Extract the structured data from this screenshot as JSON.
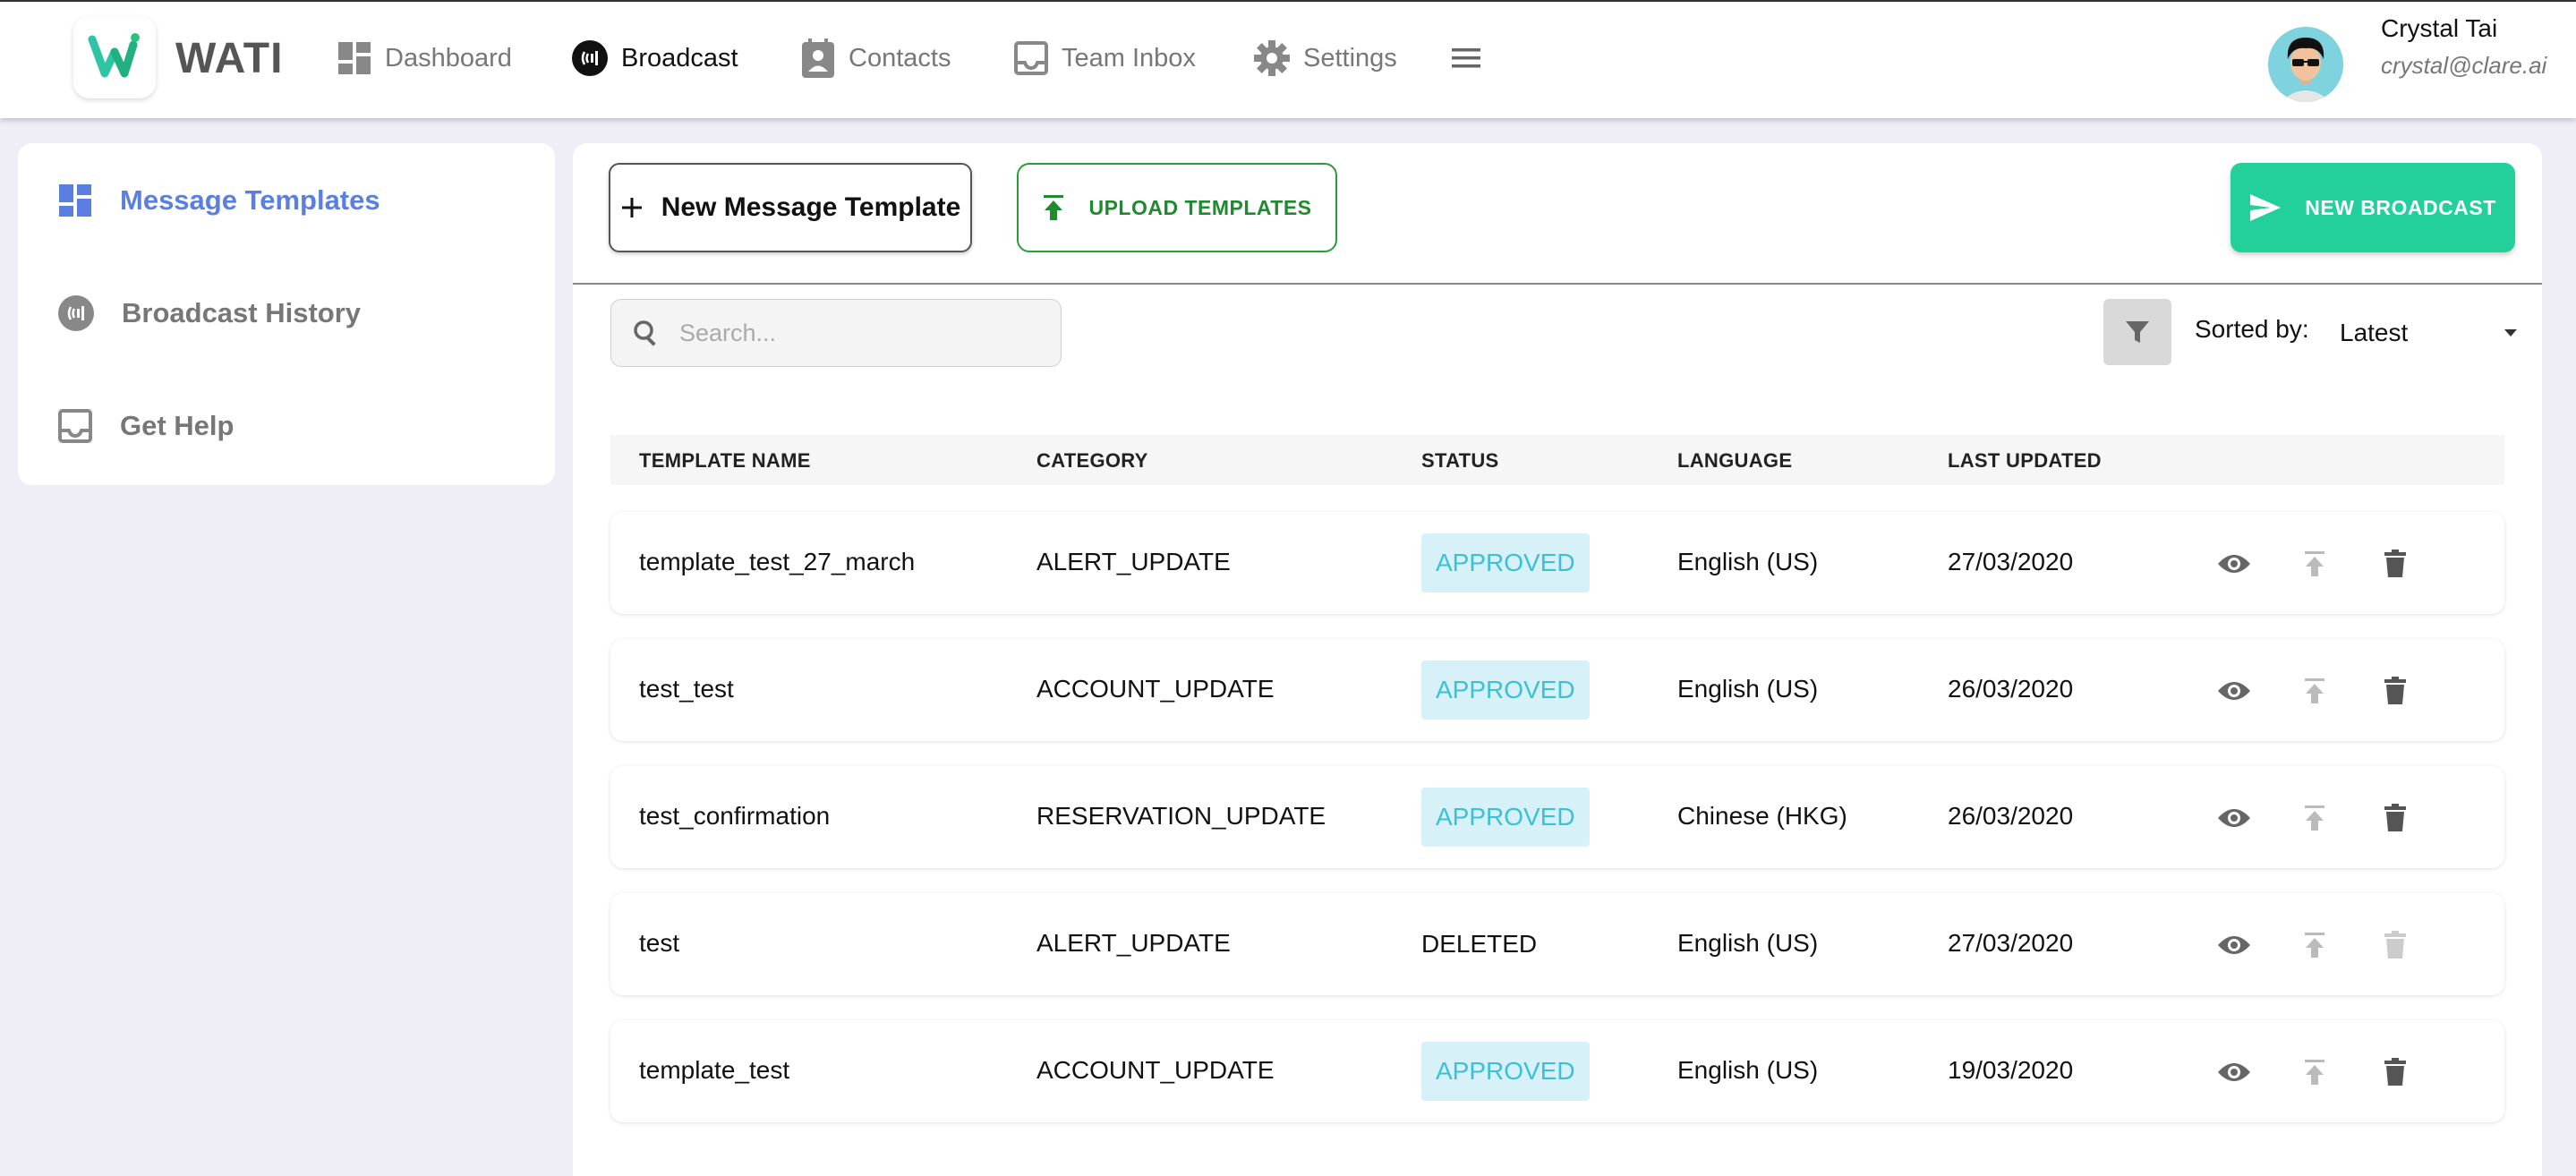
{
  "brand": {
    "name": "WATI"
  },
  "nav": {
    "items": [
      {
        "label": "Dashboard",
        "icon": "dashboard-icon"
      },
      {
        "label": "Broadcast",
        "icon": "broadcast-icon",
        "active": true
      },
      {
        "label": "Contacts",
        "icon": "contacts-icon"
      },
      {
        "label": "Team Inbox",
        "icon": "inbox-icon"
      },
      {
        "label": "Settings",
        "icon": "gear-icon"
      }
    ]
  },
  "user": {
    "name": "Crystal Tai",
    "email": "crystal@clare.ai"
  },
  "sidebar": {
    "items": [
      {
        "label": "Message Templates",
        "icon": "templates-icon",
        "active": true
      },
      {
        "label": "Broadcast History",
        "icon": "broadcast-icon"
      },
      {
        "label": "Get Help",
        "icon": "inbox-icon"
      }
    ]
  },
  "toolbar": {
    "new_template_label": "New Message Template",
    "upload_label": "UPLOAD TEMPLATES",
    "new_broadcast_label": "NEW BROADCAST"
  },
  "search": {
    "placeholder": "Search...",
    "value": ""
  },
  "sort": {
    "label": "Sorted by:",
    "value": "Latest"
  },
  "table": {
    "headers": {
      "name": "TEMPLATE NAME",
      "category": "CATEGORY",
      "status": "STATUS",
      "language": "LANGUAGE",
      "updated": "LAST UPDATED"
    },
    "rows": [
      {
        "name": "template_test_27_march",
        "category": "ALERT_UPDATE",
        "status": "APPROVED",
        "language": "English (US)",
        "updated": "27/03/2020"
      },
      {
        "name": "test_test",
        "category": "ACCOUNT_UPDATE",
        "status": "APPROVED",
        "language": "English (US)",
        "updated": "26/03/2020"
      },
      {
        "name": "test_confirmation",
        "category": "RESERVATION_UPDATE",
        "status": "APPROVED",
        "language": "Chinese (HKG)",
        "updated": "26/03/2020"
      },
      {
        "name": "test",
        "category": "ALERT_UPDATE",
        "status": "DELETED",
        "language": "English (US)",
        "updated": "27/03/2020"
      },
      {
        "name": "template_test",
        "category": "ACCOUNT_UPDATE",
        "status": "APPROVED",
        "language": "English (US)",
        "updated": "19/03/2020"
      }
    ]
  },
  "colors": {
    "accent_blue": "#5a7fe0",
    "broadcast_green": "#23cf9b",
    "upload_green": "#1f8a30",
    "approved_text": "#3cc0d8",
    "approved_bg": "#d6f1f7",
    "background": "#efeef6"
  }
}
